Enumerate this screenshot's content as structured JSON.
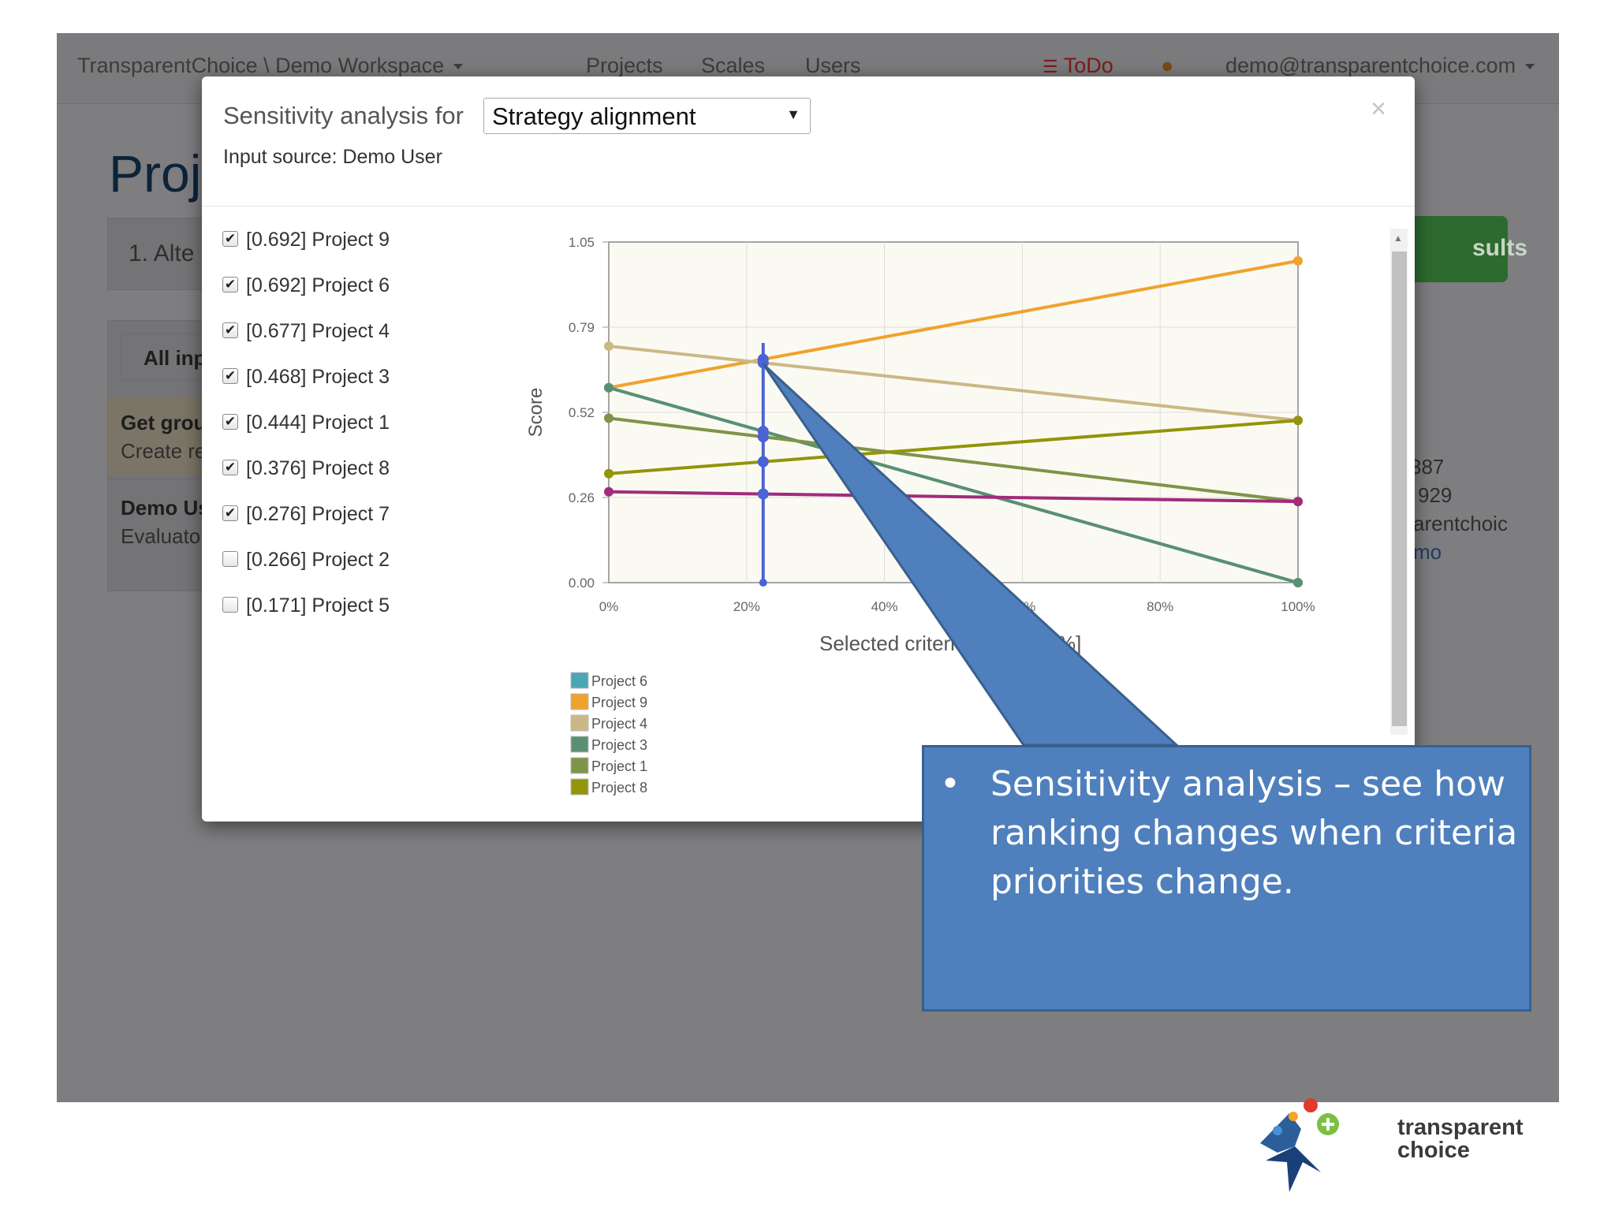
{
  "navbar": {
    "brand": "TransparentChoice \\ Demo Workspace",
    "projects": "Projects",
    "scales": "Scales",
    "users": "Users",
    "todo": "ToDo",
    "account": "demo@transparentchoice.com"
  },
  "background": {
    "page_title": "Proj",
    "step_label": "1. Alte",
    "all_inputs": "All inp",
    "group_title": "Get grou",
    "group_sub": "Create re",
    "user_title": "Demo Us",
    "user_sub": "Evaluator",
    "results_button": "sults",
    "info_1": "387",
    "info_2": "929",
    "info_3": "arentchoic",
    "info_4": "mo"
  },
  "modal": {
    "title": "Sensitivity analysis for",
    "criteria_selected": "Strategy alignment",
    "input_source": "Input source: Demo User",
    "close": "×",
    "projects": [
      {
        "label": "[0.692] Project 9",
        "checked": true
      },
      {
        "label": "[0.692] Project 6",
        "checked": true
      },
      {
        "label": "[0.677] Project 4",
        "checked": true
      },
      {
        "label": "[0.468] Project 3",
        "checked": true
      },
      {
        "label": "[0.444] Project 1",
        "checked": true
      },
      {
        "label": "[0.376] Project 8",
        "checked": true
      },
      {
        "label": "[0.276] Project 7",
        "checked": true
      },
      {
        "label": "[0.266] Project 2",
        "checked": false
      },
      {
        "label": "[0.171] Project 5",
        "checked": false
      }
    ]
  },
  "chart_data": {
    "type": "line",
    "ylabel": "Score",
    "xlabel": "Selected criteri",
    "xlabel_tail": "%]",
    "x": [
      0,
      100
    ],
    "x_ticks": [
      "0%",
      "20%",
      "40%",
      "60%",
      "80%",
      "100%"
    ],
    "y_ticks": [
      "0.00",
      "0.26",
      "0.52",
      "0.79",
      "1.05"
    ],
    "ylim": [
      0,
      1.05
    ],
    "xlim": [
      0,
      100
    ],
    "grid": true,
    "current_weight": 22.4,
    "series": [
      {
        "name": "Project 6",
        "values": [
          0.601,
          0.0
        ],
        "color": "#4aa6b4"
      },
      {
        "name": "Project 9",
        "values": [
          0.601,
          0.992
        ],
        "color": "#f0a22e"
      },
      {
        "name": "Project 4",
        "values": [
          0.729,
          0.5
        ],
        "color": "#cbb887"
      },
      {
        "name": "Project 3",
        "values": [
          0.601,
          0.0
        ],
        "color": "#5a9072"
      },
      {
        "name": "Project 1",
        "values": [
          0.507,
          0.25
        ],
        "color": "#7e9448"
      },
      {
        "name": "Project 8",
        "values": [
          0.336,
          0.5
        ],
        "color": "#93950a"
      },
      {
        "name": "",
        "values": [
          0.28,
          0.25
        ],
        "color": "#a02c7a"
      }
    ],
    "legend": [
      "Project 6",
      "Project 9",
      "Project 4",
      "Project 3",
      "Project 1",
      "Project 8"
    ],
    "legend_placement": "bottom-left"
  },
  "callout": {
    "bullet": "•",
    "text": "Sensitivity analysis – see how ranking changes when criteria priorities change."
  },
  "logo": {
    "line1": "transparent",
    "line2": "choice"
  }
}
